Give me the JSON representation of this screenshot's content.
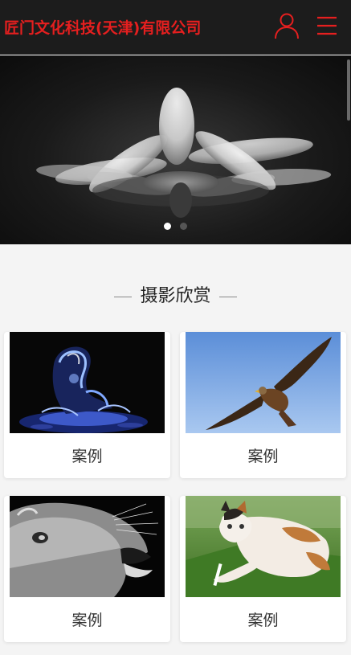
{
  "header": {
    "company_name": "匠门文化科技(天津)有限公司",
    "brand_color": "#e51f1f",
    "user_icon": "user-icon",
    "menu_icon": "menu-icon"
  },
  "banner": {
    "slide_count": 2,
    "active_slide": 1
  },
  "section": {
    "title": "摄影欣赏"
  },
  "cases": [
    {
      "caption": "案例",
      "image": "water-sculpture"
    },
    {
      "caption": "案例",
      "image": "flying-eagle"
    },
    {
      "caption": "案例",
      "image": "roaring-lioness"
    },
    {
      "caption": "案例",
      "image": "kitten-on-grass"
    }
  ]
}
